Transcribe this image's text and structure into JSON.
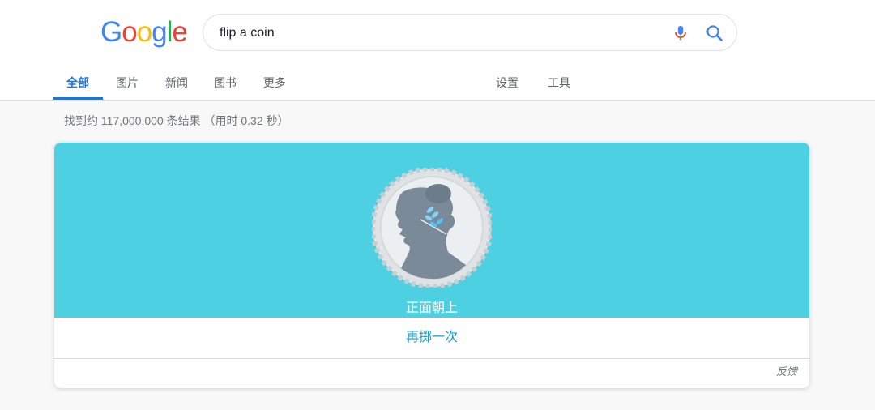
{
  "logo": {
    "letters": [
      "G",
      "o",
      "o",
      "g",
      "l",
      "e"
    ],
    "colors": [
      "#4285f4",
      "#ea4335",
      "#fbbc05",
      "#4285f4",
      "#34a853",
      "#ea4335"
    ]
  },
  "search": {
    "value": "flip a coin",
    "mic_icon": "microphone-icon",
    "search_icon": "search-icon"
  },
  "tabs": [
    {
      "label": "全部",
      "active": true
    },
    {
      "label": "图片"
    },
    {
      "label": "新闻"
    },
    {
      "label": "图书"
    },
    {
      "label": "更多"
    },
    {
      "label": "设置"
    },
    {
      "label": "工具"
    }
  ],
  "result_stats": "找到约 117,000,000 条结果 （用时 0.32 秒）",
  "coin_card": {
    "result": "正面朝上",
    "flip_again": "再掷一次",
    "feedback": "反馈",
    "panel_color": "#4dd0e1",
    "coin_icon": "coin-heads-icon"
  }
}
